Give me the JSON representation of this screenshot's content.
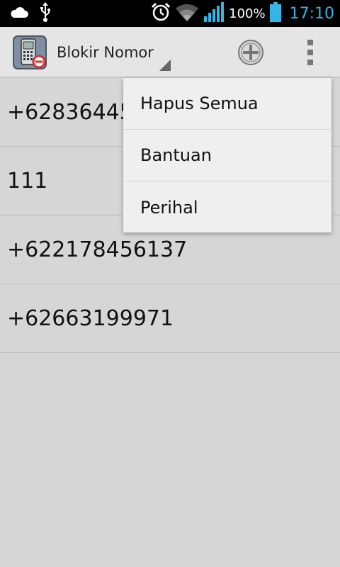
{
  "status_bar": {
    "icons": [
      "cloud-icon",
      "usb-icon",
      "alarm-clock-icon",
      "wifi-icon",
      "signal-icon",
      "battery-icon"
    ],
    "battery_percent": "100%",
    "time": "17:10",
    "clock_color": "#33b5e5"
  },
  "action_bar": {
    "app_icon": "phone-block-icon",
    "title": "Blokir Nomor",
    "add_icon": "add-circle-icon",
    "overflow_icon": "overflow-menu-icon"
  },
  "blocked_numbers": [
    {
      "number": "+62836445"
    },
    {
      "number": "111"
    },
    {
      "number": "+622178456137"
    },
    {
      "number": "+62663199971"
    }
  ],
  "overflow_menu": {
    "items": [
      {
        "label": "Hapus Semua"
      },
      {
        "label": "Bantuan"
      },
      {
        "label": "Perihal"
      }
    ]
  }
}
